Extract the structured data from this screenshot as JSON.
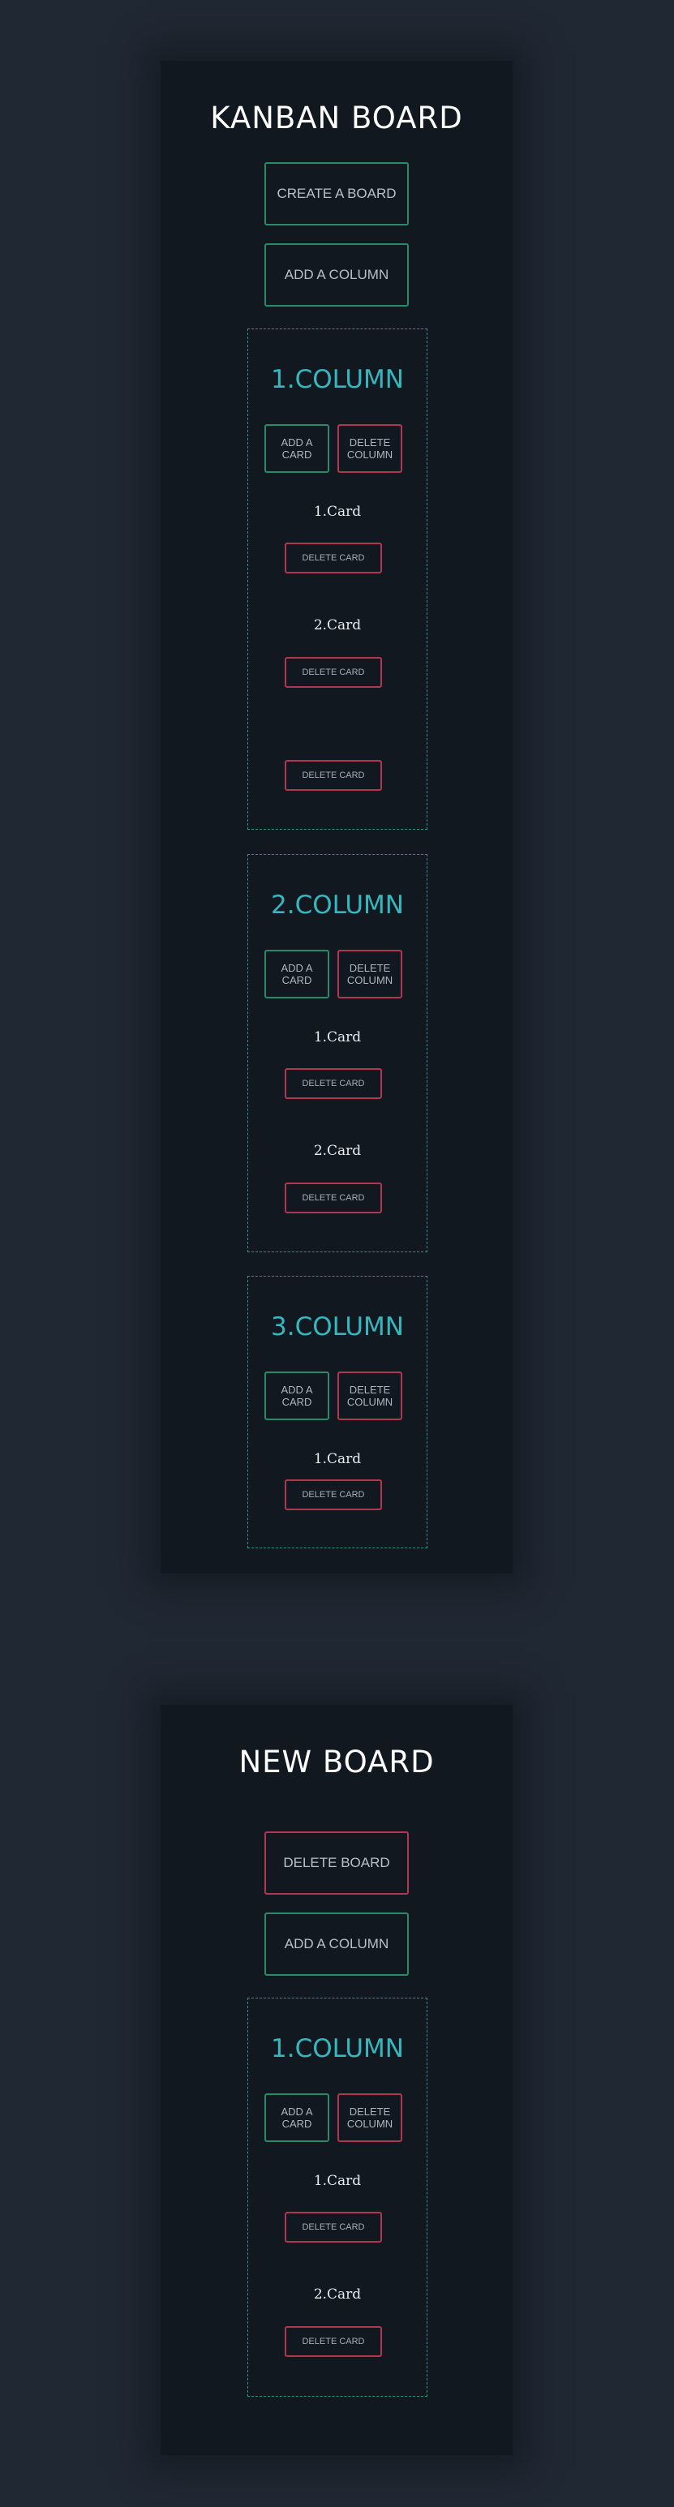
{
  "boards": [
    {
      "title": "KANBAN BOARD",
      "primary_button": "CREATE A BOARD",
      "add_column_button": "ADD A COLUMN",
      "columns": [
        {
          "title": "1.COLUMN",
          "add_card": "ADD A CARD",
          "delete_column": "DELETE COLUMN",
          "cards": [
            {
              "title": "1.Card",
              "delete": "DELETE CARD"
            },
            {
              "title": "2.Card",
              "delete": "DELETE CARD"
            },
            {
              "title": "",
              "delete": "DELETE CARD"
            }
          ]
        },
        {
          "title": "2.COLUMN",
          "add_card": "ADD A CARD",
          "delete_column": "DELETE COLUMN",
          "cards": [
            {
              "title": "1.Card",
              "delete": "DELETE CARD"
            },
            {
              "title": "2.Card",
              "delete": "DELETE CARD"
            }
          ]
        },
        {
          "title": "3.COLUMN",
          "add_card": "ADD A CARD",
          "delete_column": "DELETE COLUMN",
          "cards": [
            {
              "title": "1.Card",
              "delete": "DELETE CARD"
            }
          ]
        }
      ]
    },
    {
      "title": "NEW BOARD",
      "primary_button": "DELETE BOARD",
      "add_column_button": "ADD A COLUMN",
      "columns": [
        {
          "title": "1.COLUMN",
          "add_card": "ADD A CARD",
          "delete_column": "DELETE COLUMN",
          "cards": [
            {
              "title": "1.Card",
              "delete": "DELETE CARD"
            },
            {
              "title": "2.Card",
              "delete": "DELETE CARD"
            }
          ]
        }
      ]
    }
  ],
  "colors": {
    "page_bg": "#202833",
    "board_bg": "#111820",
    "accent_teal": "#36b7bd",
    "border_green": "#2b8a66",
    "border_red": "#b1364f"
  }
}
